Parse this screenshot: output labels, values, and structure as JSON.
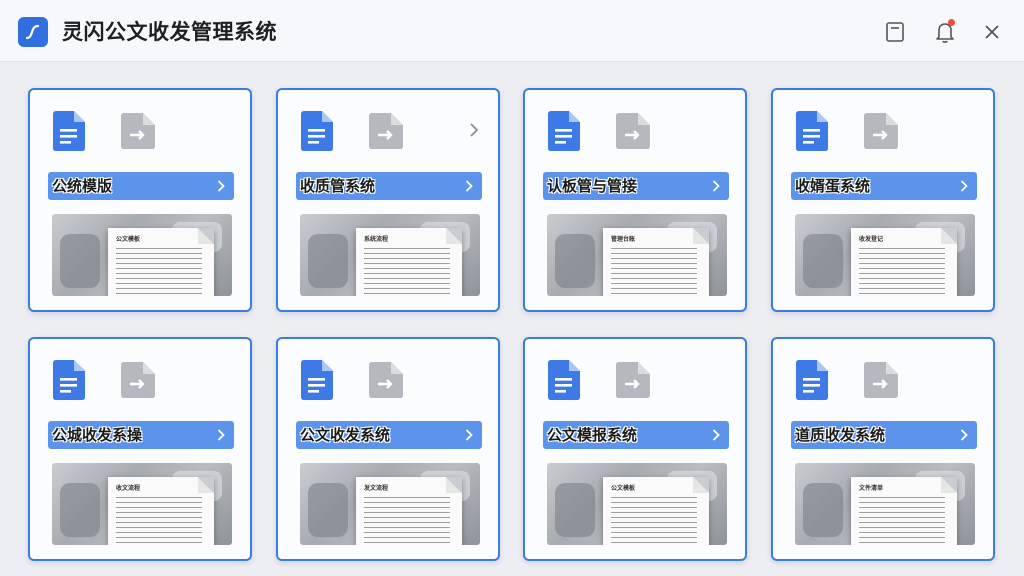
{
  "window": {
    "title": "灵闪公文收发管理系统",
    "accent_color": "#3e7be0",
    "buttons": [
      "save-icon",
      "bell-icon",
      "close-icon"
    ]
  },
  "cards": [
    {
      "label": "公统模版",
      "preview_heading": "公文模板"
    },
    {
      "label": "收质管系统",
      "preview_heading": "系统流程"
    },
    {
      "label": "认板管与管接",
      "preview_heading": "管理台账"
    },
    {
      "label": "收婿蛋系统",
      "preview_heading": "收发登记"
    },
    {
      "label": "公城收发系操",
      "preview_heading": "收文流程"
    },
    {
      "label": "公文收发系统",
      "preview_heading": "发文流程"
    },
    {
      "label": "公文模报系统",
      "preview_heading": "公文模板"
    },
    {
      "label": "道质收发系统",
      "preview_heading": "文件清单"
    }
  ]
}
